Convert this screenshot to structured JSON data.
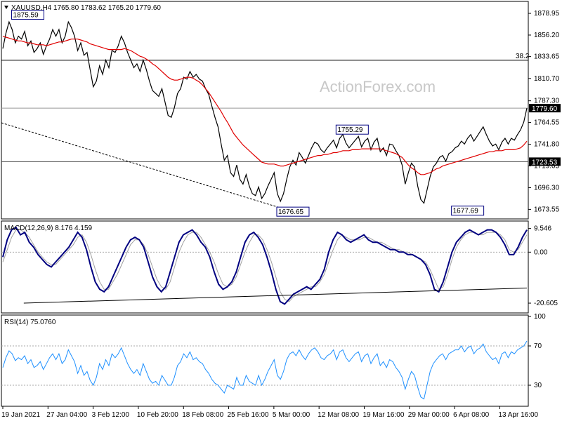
{
  "header": {
    "main": "XAUUSD,H4  1765.80 1783.62 1765.20 1779.60",
    "macd": "MACD(12,26,9) 8.176 4.159",
    "rsi": "RSI(14) 75.0760"
  },
  "watermark": "ActionForex.com",
  "colors": {
    "price": "#000000",
    "ma": "#e00000",
    "macd": "#000080",
    "signal": "#a0a0a0",
    "rsi": "#1e90ff",
    "grid": "#a8a8a8",
    "hline": "#000000"
  },
  "chart_data": {
    "type": "line",
    "x_labels": [
      "19 Jan 2021",
      "27 Jan 04:00",
      "3 Feb 12:00",
      "10 Feb 20:00",
      "18 Feb 08:00",
      "25 Feb 16:00",
      "5 Mar 00:00",
      "12 Mar 08:00",
      "19 Mar 16:00",
      "29 Mar 00:00",
      "6 Apr 08:00",
      "13 Apr 16:00"
    ],
    "price_panel": {
      "ylim": [
        1665,
        1890
      ],
      "yticks": [
        1878.95,
        1856.2,
        1833.65,
        1810.7,
        1787.3,
        1764.55,
        1741.8,
        1719.05,
        1696.3,
        1673.55
      ],
      "current": {
        "label": "1779.60",
        "value": 1779.6
      },
      "level_label": {
        "label": "1723.53",
        "value": 1723.53
      },
      "fib": {
        "label": "38.2",
        "value": 1829.8
      },
      "annotations": [
        {
          "label": "1875.59",
          "x": 8,
          "y": 1875.59
        },
        {
          "label": "1755.29",
          "x": 112,
          "y": 1755.29
        },
        {
          "label": "1676.65",
          "x": 93,
          "y": 1676.65
        },
        {
          "label": "1677.69",
          "x": 149,
          "y": 1677.69
        }
      ],
      "close": [
        1842,
        1858,
        1870,
        1862,
        1848,
        1855,
        1852,
        1860,
        1845,
        1850,
        1838,
        1842,
        1848,
        1836,
        1845,
        1852,
        1862,
        1855,
        1862,
        1848,
        1855,
        1870,
        1864,
        1855,
        1840,
        1848,
        1835,
        1838,
        1820,
        1802,
        1808,
        1824,
        1815,
        1830,
        1822,
        1840,
        1838,
        1845,
        1855,
        1848,
        1838,
        1830,
        1822,
        1826,
        1818,
        1830,
        1820,
        1808,
        1798,
        1795,
        1792,
        1800,
        1786,
        1772,
        1770,
        1780,
        1795,
        1800,
        1812,
        1810,
        1818,
        1812,
        1815,
        1810,
        1808,
        1800,
        1794,
        1782,
        1770,
        1760,
        1742,
        1725,
        1730,
        1712,
        1708,
        1720,
        1705,
        1700,
        1710,
        1698,
        1690,
        1688,
        1697,
        1685,
        1690,
        1698,
        1705,
        1712,
        1690,
        1682,
        1690,
        1705,
        1718,
        1725,
        1720,
        1733,
        1728,
        1722,
        1730,
        1738,
        1744,
        1742,
        1736,
        1733,
        1738,
        1742,
        1746,
        1738,
        1748,
        1752,
        1743,
        1738,
        1742,
        1746,
        1750,
        1739,
        1745,
        1748,
        1736,
        1744,
        1748,
        1734,
        1738,
        1730,
        1742,
        1741,
        1735,
        1730,
        1720,
        1700,
        1712,
        1722,
        1718,
        1698,
        1684,
        1680,
        1694,
        1708,
        1718,
        1722,
        1728,
        1730,
        1724,
        1732,
        1734,
        1738,
        1740,
        1745,
        1742,
        1748,
        1752,
        1745,
        1750,
        1755,
        1760,
        1752,
        1745,
        1740,
        1742,
        1736,
        1744,
        1748,
        1742,
        1748,
        1746,
        1752,
        1757,
        1765,
        1779.6
      ],
      "ma": [
        1855,
        1854,
        1853,
        1852,
        1851,
        1850,
        1850,
        1849,
        1848,
        1848,
        1847,
        1846,
        1846,
        1846,
        1845,
        1846,
        1847,
        1848,
        1849,
        1849,
        1850,
        1851,
        1852,
        1852,
        1852,
        1851,
        1850,
        1849,
        1847,
        1846,
        1845,
        1844,
        1843,
        1842,
        1841,
        1841,
        1841,
        1841,
        1841,
        1842,
        1841,
        1840,
        1838,
        1836,
        1834,
        1833,
        1831,
        1829,
        1826,
        1824,
        1821,
        1818,
        1815,
        1812,
        1810,
        1809,
        1809,
        1810,
        1811,
        1812,
        1812,
        1811,
        1809,
        1807,
        1804,
        1800,
        1796,
        1791,
        1786,
        1781,
        1776,
        1770,
        1765,
        1759,
        1753,
        1749,
        1745,
        1741,
        1738,
        1735,
        1732,
        1729,
        1726,
        1723,
        1722,
        1721,
        1721,
        1721,
        1720,
        1719,
        1719,
        1720,
        1721,
        1722,
        1723,
        1724,
        1725,
        1726,
        1727,
        1728,
        1729,
        1730,
        1730,
        1731,
        1731,
        1732,
        1733,
        1733,
        1734,
        1735,
        1735,
        1735,
        1736,
        1736,
        1736,
        1737,
        1737,
        1737,
        1737,
        1737,
        1737,
        1737,
        1736,
        1735,
        1734,
        1733,
        1732,
        1730,
        1728,
        1724,
        1720,
        1717,
        1715,
        1712,
        1710,
        1710,
        1711,
        1712,
        1714,
        1716,
        1717,
        1719,
        1720,
        1721,
        1722,
        1723,
        1724,
        1725,
        1726,
        1727,
        1728,
        1729,
        1730,
        1731,
        1732,
        1733,
        1734,
        1734,
        1735,
        1735,
        1735,
        1736,
        1736,
        1736,
        1736,
        1737,
        1738,
        1741,
        1745
      ]
    },
    "macd_panel": {
      "ylim": [
        -24,
        12
      ],
      "yticks": [
        9.546,
        0.0,
        -20.605
      ],
      "macd": [
        -2,
        5,
        9,
        10,
        7,
        8,
        4,
        2,
        -1,
        -3,
        -5,
        -6,
        -4,
        -2,
        0,
        2,
        5,
        8,
        6,
        1,
        -6,
        -12,
        -15,
        -16,
        -14,
        -10,
        -6,
        -2,
        2,
        5,
        6,
        5,
        2,
        -4,
        -10,
        -14,
        -16,
        -14,
        -8,
        -2,
        4,
        7,
        8,
        9,
        7,
        4,
        2,
        -2,
        -8,
        -13,
        -15,
        -14,
        -12,
        -8,
        -2,
        4,
        7,
        8,
        6,
        3,
        -2,
        -8,
        -15,
        -20,
        -21,
        -19,
        -17,
        -16,
        -15,
        -14,
        -15,
        -13,
        -11,
        -7,
        0,
        5,
        8,
        7,
        5,
        4,
        5,
        6,
        7,
        5,
        4,
        4,
        3,
        2,
        1,
        1,
        0,
        0,
        -1,
        -1,
        -2,
        -3,
        -5,
        -9,
        -15,
        -16,
        -12,
        -6,
        0,
        4,
        6,
        8,
        9,
        8,
        7,
        8,
        9,
        9,
        8,
        6,
        3,
        -1,
        -1,
        2,
        6,
        9
      ],
      "signal": [
        -4,
        1,
        6,
        9,
        9,
        8,
        6,
        3,
        0,
        -2,
        -4,
        -5,
        -5,
        -3,
        -1,
        1,
        3,
        6,
        7,
        4,
        -1,
        -7,
        -12,
        -15,
        -15,
        -12,
        -9,
        -5,
        -1,
        3,
        5,
        5,
        3,
        -1,
        -6,
        -11,
        -14,
        -15,
        -12,
        -6,
        0,
        4,
        7,
        8,
        8,
        6,
        3,
        0,
        -4,
        -9,
        -13,
        -14,
        -13,
        -10,
        -5,
        0,
        4,
        7,
        7,
        5,
        1,
        -4,
        -10,
        -16,
        -19,
        -20,
        -18,
        -17,
        -16,
        -15,
        -14,
        -14,
        -12,
        -9,
        -4,
        1,
        5,
        7,
        6,
        5,
        5,
        5,
        6,
        6,
        5,
        4,
        4,
        3,
        2,
        1,
        1,
        0,
        0,
        -1,
        -2,
        -3,
        -4,
        -7,
        -11,
        -15,
        -14,
        -9,
        -3,
        2,
        5,
        7,
        8,
        8,
        7,
        7,
        8,
        8,
        8,
        7,
        5,
        1,
        0,
        1,
        4,
        7
      ],
      "trendline": [
        [
          -20.6,
          0.04
        ],
        [
          -14.5,
          0.98
        ]
      ]
    },
    "rsi_panel": {
      "ylim": [
        10,
        100
      ],
      "yticks": [
        100,
        70,
        30
      ],
      "levels": [
        70,
        30
      ],
      "values": [
        48,
        58,
        65,
        62,
        55,
        58,
        56,
        60,
        52,
        56,
        48,
        50,
        54,
        46,
        52,
        58,
        62,
        56,
        62,
        52,
        56,
        66,
        60,
        54,
        42,
        50,
        40,
        44,
        35,
        30,
        38,
        52,
        46,
        56,
        50,
        62,
        58,
        62,
        68,
        60,
        52,
        46,
        42,
        46,
        40,
        52,
        44,
        36,
        32,
        34,
        30,
        40,
        35,
        30,
        30,
        38,
        50,
        54,
        62,
        58,
        64,
        56,
        58,
        54,
        52,
        46,
        42,
        36,
        32,
        30,
        26,
        22,
        30,
        28,
        26,
        38,
        30,
        30,
        40,
        34,
        32,
        30,
        40,
        30,
        36,
        44,
        50,
        56,
        40,
        36,
        44,
        56,
        62,
        64,
        60,
        66,
        60,
        56,
        62,
        66,
        68,
        64,
        58,
        56,
        60,
        62,
        66,
        56,
        64,
        66,
        58,
        54,
        58,
        62,
        64,
        54,
        60,
        62,
        52,
        58,
        62,
        50,
        54,
        48,
        56,
        54,
        48,
        44,
        38,
        26,
        36,
        44,
        40,
        28,
        18,
        16,
        30,
        44,
        52,
        56,
        60,
        62,
        56,
        62,
        64,
        66,
        66,
        70,
        64,
        68,
        70,
        62,
        66,
        68,
        72,
        64,
        60,
        56,
        58,
        52,
        62,
        64,
        58,
        64,
        62,
        66,
        68,
        70,
        75
      ]
    }
  }
}
